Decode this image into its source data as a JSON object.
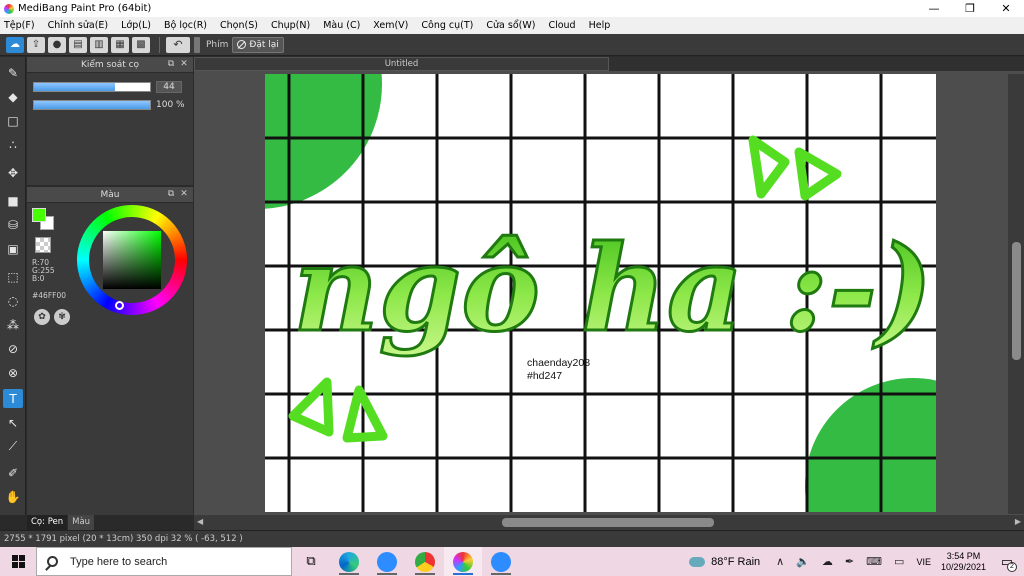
{
  "window": {
    "title": "MediBang Paint Pro (64bit)",
    "controls": {
      "minimize": "—",
      "maximize": "❐",
      "close": "✕"
    }
  },
  "menu": [
    "Tệp(F)",
    "Chỉnh sửa(E)",
    "Lớp(L)",
    "Bộ lọc(R)",
    "Chọn(S)",
    "Chụp(N)",
    "Màu (C)",
    "Xem(V)",
    "Công cụ(T)",
    "Cửa sổ(W)",
    "Cloud",
    "Help"
  ],
  "toolbar": {
    "label_key": "Phím",
    "reset_label": "Đặt lại"
  },
  "brush_panel": {
    "title": "Kiểm soát cọ",
    "size_value": "44",
    "size_fraction": 0.7,
    "opacity_value": "100 %",
    "opacity_fraction": 1.0
  },
  "color_panel": {
    "title": "Màu",
    "foreground": "#46FF00",
    "background": "#FFFFFF",
    "r": "R:70",
    "g": "G:255",
    "b": "B:0",
    "hex": "#46FF00"
  },
  "bottom_tabs": [
    "Cọ: Pen",
    "Màu"
  ],
  "document": {
    "tab_title": "Untitled"
  },
  "artwork": {
    "main_text": "ngô ha :-)",
    "credit_line1": "chaenday208",
    "credit_line2": "#hd247",
    "accent": "#33bb44",
    "text_green": "#44cc22"
  },
  "status": {
    "text": "2755 * 1791 pixel  (20 * 13cm)  350 dpi  32 %  ( -63, 512 )"
  },
  "taskbar": {
    "search_placeholder": "Type here to search",
    "weather_temp": "88°F",
    "weather_label": "Rain",
    "lang": "VIE",
    "time": "3:54 PM",
    "date": "10/29/2021",
    "notifications": "2"
  }
}
